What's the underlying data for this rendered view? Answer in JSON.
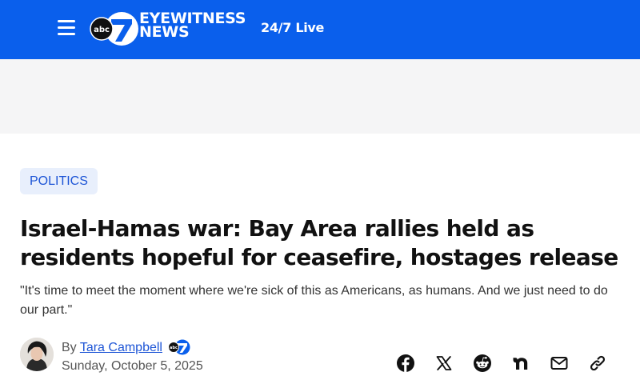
{
  "header": {
    "menu_icon": "hamburger-menu-icon",
    "logo": {
      "abc_mark": "abc",
      "numeral": "7",
      "line1": "EYEWITNESS",
      "line2": "NEWS"
    },
    "live_label": "24/7 Live",
    "background_color": "#0a5fec"
  },
  "article": {
    "category": "POLITICS",
    "headline": "Israel-Hamas war: Bay Area rallies held as residents hopeful for ceasefire, hostages release",
    "dek": "\"It's time to meet the moment where we're sick of this as Americans, as humans. And we just need to do our part.\"",
    "byline": {
      "prefix": "By",
      "author": "Tara Campbell",
      "date": "Sunday, October 5, 2025"
    },
    "share_icons": [
      "facebook-icon",
      "x-icon",
      "reddit-icon",
      "nextdoor-icon",
      "email-icon",
      "link-icon"
    ]
  },
  "colors": {
    "accent": "#1d55d6",
    "tag_background": "#e8effc",
    "ad_band": "#f5f5f6"
  }
}
